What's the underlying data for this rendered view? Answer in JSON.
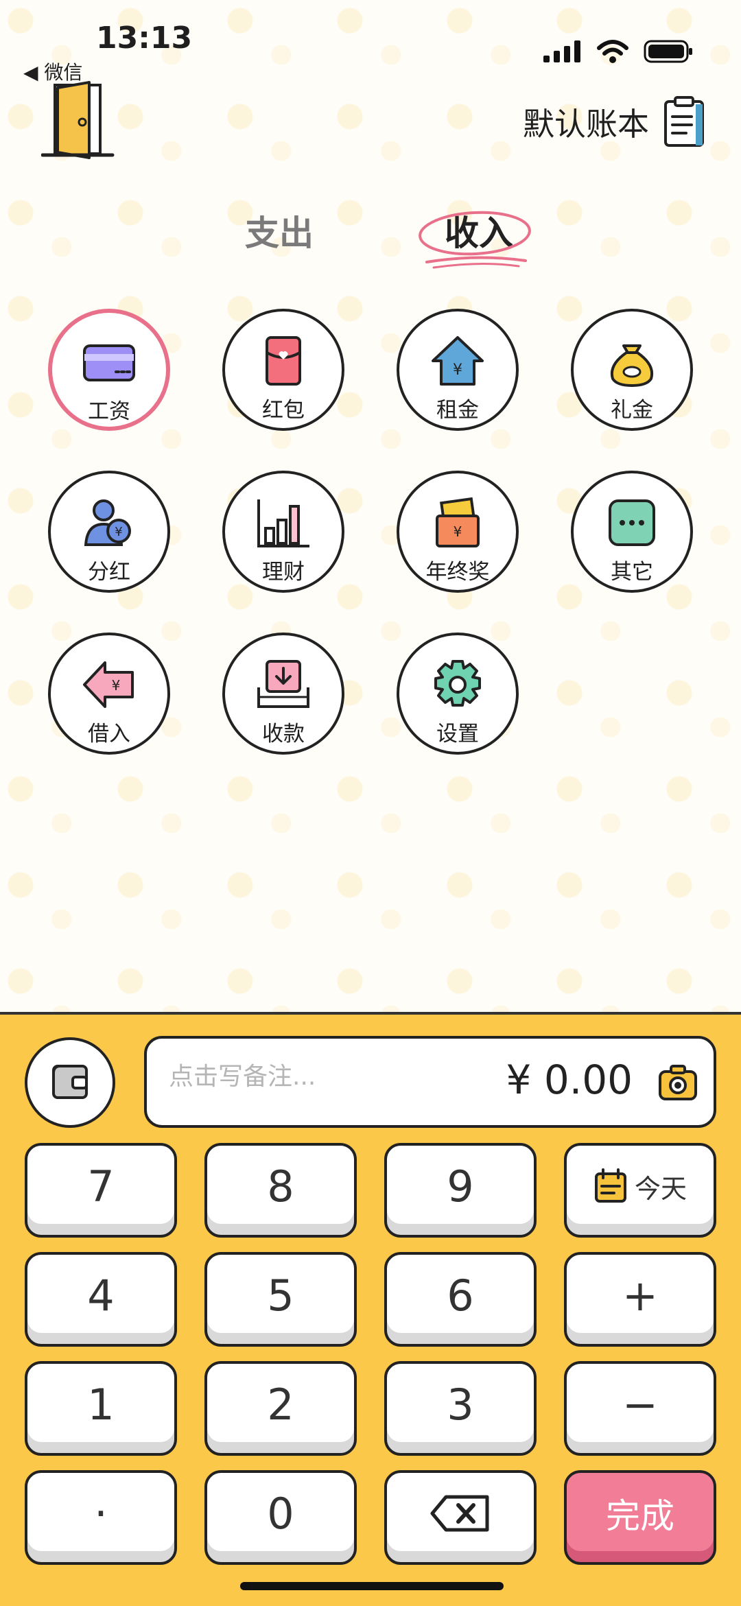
{
  "status_bar": {
    "time": "13:13",
    "back_app": "◀ 微信"
  },
  "header": {
    "ledger_label": "默认账本"
  },
  "tabs": {
    "expense": "支出",
    "income": "收入",
    "active": "income"
  },
  "categories": [
    {
      "label": "工资",
      "icon": "bank-card-icon",
      "selected": true
    },
    {
      "label": "红包",
      "icon": "red-envelope-icon"
    },
    {
      "label": "租金",
      "icon": "house-yuan-icon"
    },
    {
      "label": "礼金",
      "icon": "money-bag-icon"
    },
    {
      "label": "分红",
      "icon": "people-coin-icon"
    },
    {
      "label": "理财",
      "icon": "bar-chart-icon"
    },
    {
      "label": "年终奖",
      "icon": "bonus-envelope-icon"
    },
    {
      "label": "其它",
      "icon": "more-dots-icon"
    },
    {
      "label": "借入",
      "icon": "borrow-arrow-icon"
    },
    {
      "label": "收款",
      "icon": "receive-tray-icon"
    },
    {
      "label": "设置",
      "icon": "gear-icon"
    }
  ],
  "entry": {
    "note_placeholder": "点击写备注...",
    "amount": "¥ 0.00"
  },
  "keypad": {
    "k7": "7",
    "k8": "8",
    "k9": "9",
    "today": "今天",
    "k4": "4",
    "k5": "5",
    "k6": "6",
    "plus": "+",
    "k1": "1",
    "k2": "2",
    "k3": "3",
    "minus": "−",
    "dot": "·",
    "k0": "0",
    "done": "完成"
  },
  "colors": {
    "keypad_bg": "#fcc84a",
    "done_button": "#f27d97",
    "selected_ring": "#e8708a",
    "tab_underline": "#e8708a"
  }
}
